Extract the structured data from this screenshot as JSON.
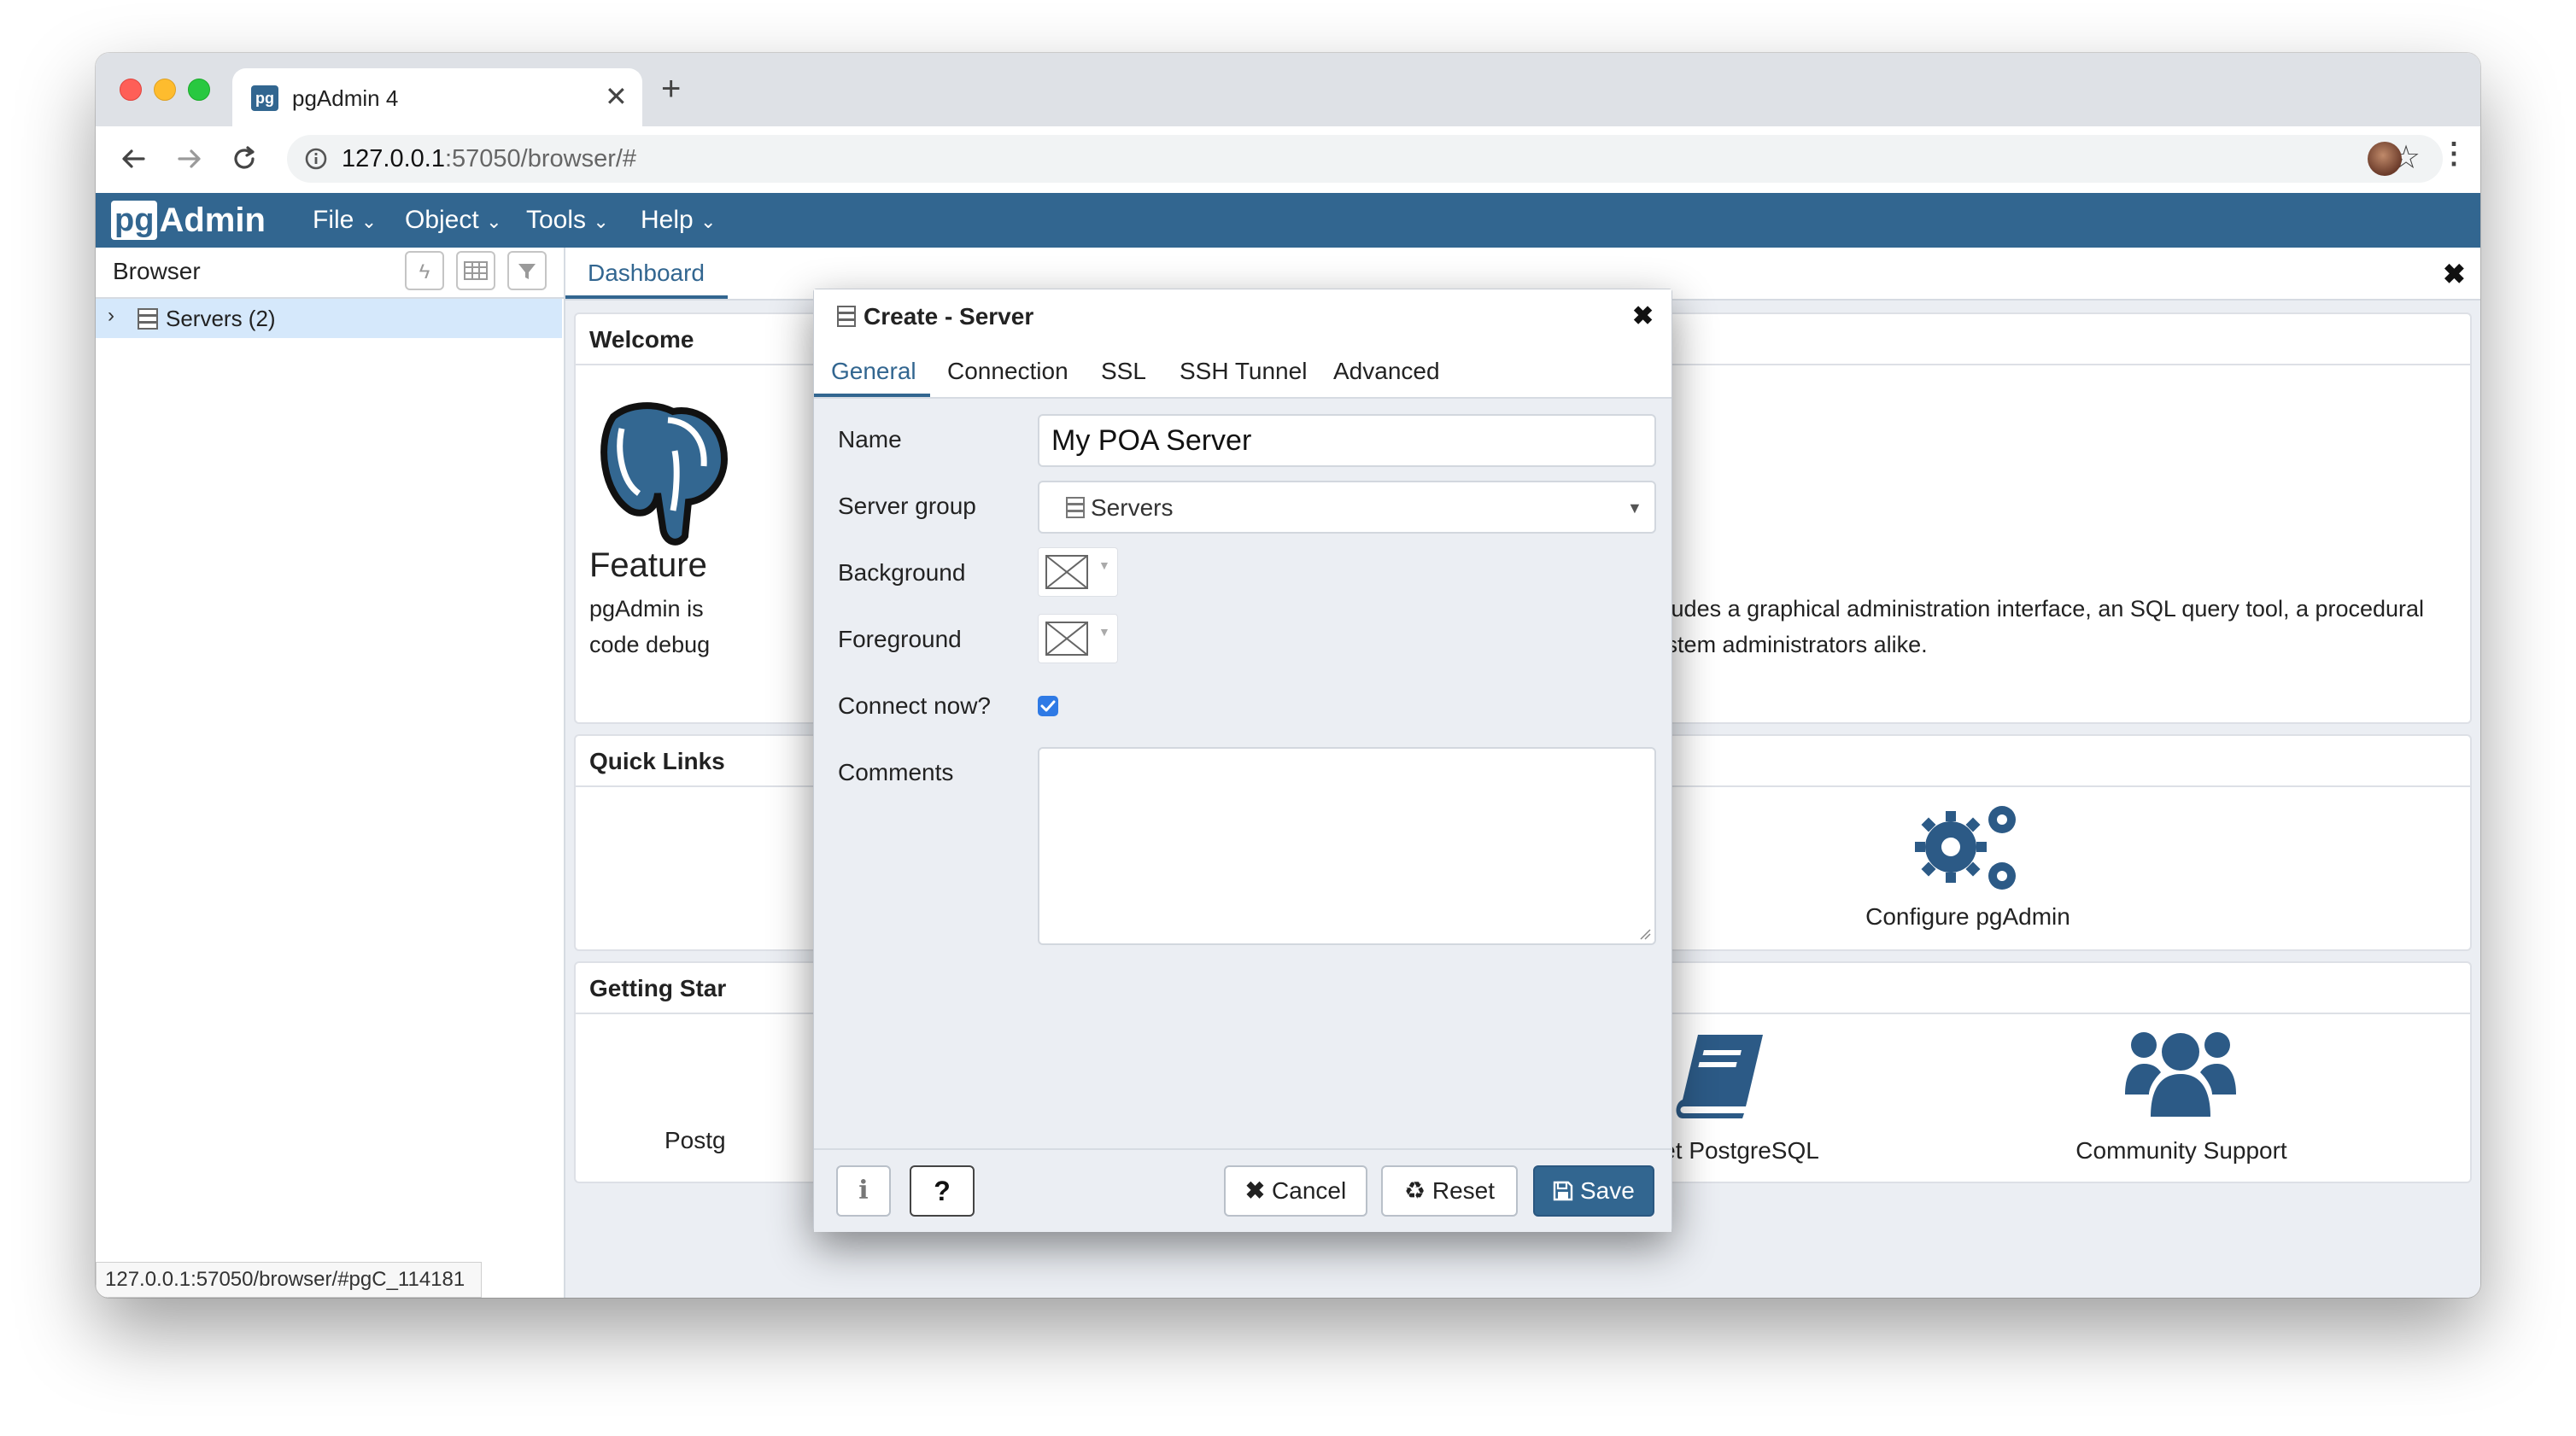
{
  "browser": {
    "tab_title": "pgAdmin 4",
    "new_tab": "+",
    "url_host": "127.0.0.1",
    "url_rest": ":57050/browser/#",
    "status_url": "127.0.0.1:57050/browser/#pgC_114181"
  },
  "app": {
    "logo_pg": "pg",
    "logo_admin": "Admin",
    "menus": [
      "File",
      "Object",
      "Tools",
      "Help"
    ]
  },
  "left_panel": {
    "title": "Browser",
    "tree": {
      "servers_label": "Servers (2)"
    }
  },
  "dashboard": {
    "tab_label": "Dashboard",
    "welcome_title": "Welcome",
    "feature_heading": "Feature",
    "desc_left_1": "pgAdmin is ",
    "desc_left_2": "code debug",
    "desc_right_1": "se. It includes a graphical administration interface, an SQL query tool, a procedural",
    "desc_right_2": "s and system administrators alike.",
    "quick_links_title": "Quick Links",
    "configure_label": "Configure pgAdmin",
    "getting_started_title": "Getting Star",
    "postgres_label_partial": "Postg",
    "planet_label": "Planet PostgreSQL",
    "community_label": "Community Support"
  },
  "dialog": {
    "title": "Create - Server",
    "tabs": [
      "General",
      "Connection",
      "SSL",
      "SSH Tunnel",
      "Advanced"
    ],
    "active_tab": "General",
    "fields": {
      "name_label": "Name",
      "name_value": "My POA Server",
      "server_group_label": "Server group",
      "server_group_value": "Servers",
      "background_label": "Background",
      "foreground_label": "Foreground",
      "connect_now_label": "Connect now?",
      "connect_now_checked": true,
      "comments_label": "Comments",
      "comments_value": ""
    },
    "buttons": {
      "info": "i",
      "help": "?",
      "cancel": "Cancel",
      "reset": "Reset",
      "save": "Save"
    }
  },
  "colors": {
    "brand_blue": "#326690",
    "tab_active": "#326690",
    "selection": "#d5e8fb"
  }
}
